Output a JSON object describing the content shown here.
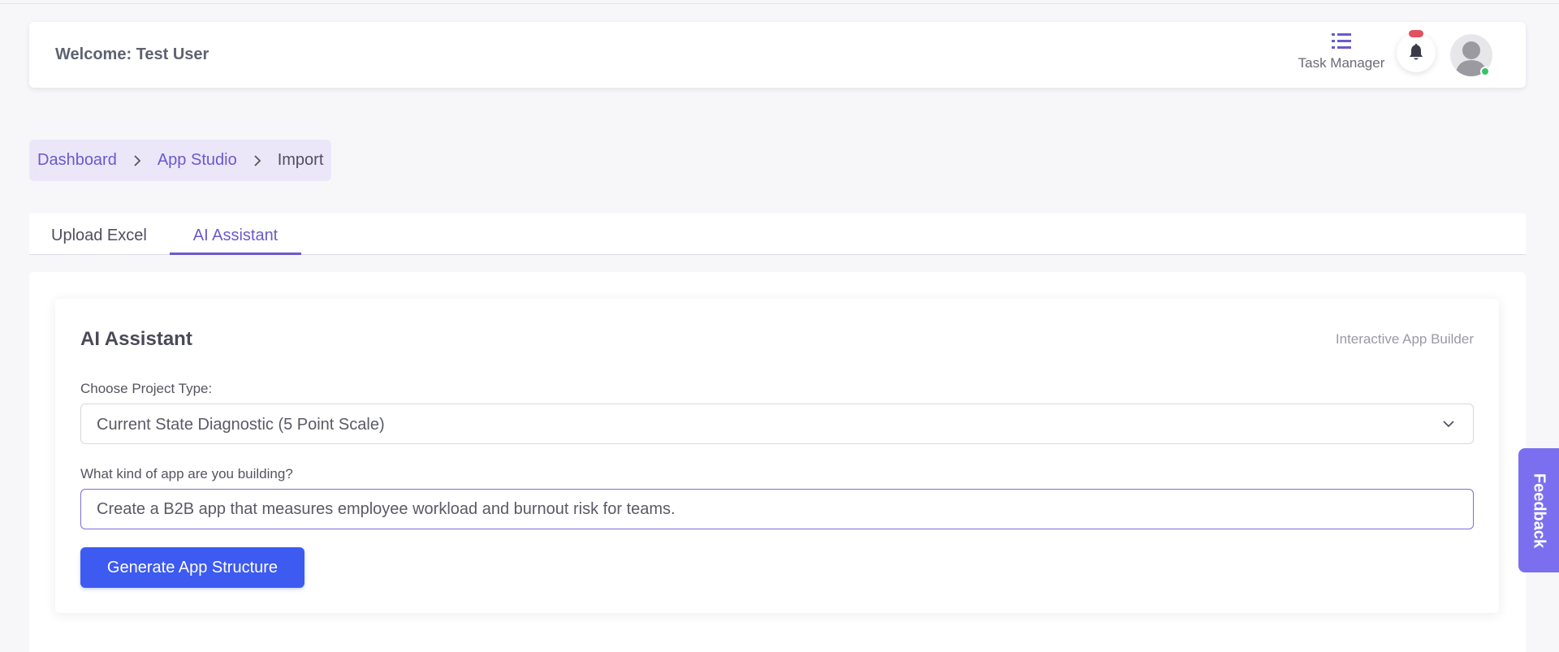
{
  "header": {
    "welcome_text": "Welcome: Test User",
    "task_manager_label": "Task Manager",
    "icons": [
      "list-icon",
      "bell-icon",
      "avatar-icon"
    ]
  },
  "breadcrumb": {
    "items": [
      "Dashboard",
      "App Studio",
      "Import"
    ]
  },
  "tabs": [
    {
      "label": "Upload Excel",
      "active": false
    },
    {
      "label": "AI Assistant",
      "active": true
    }
  ],
  "card": {
    "title": "AI Assistant",
    "subtitle": "Interactive App Builder",
    "project_type_label": "Choose Project Type:",
    "project_type_value": "Current State Diagnostic (5 Point Scale)",
    "app_question_label": "What kind of app are you building?",
    "app_description_value": "Create a B2B app that measures employee workload and burnout risk for teams.",
    "generate_button_label": "Generate App Structure"
  },
  "feedback_label": "Feedback",
  "colors": {
    "accent": "#6a5acd",
    "primary_button": "#3d5af1",
    "breadcrumb_bg": "#ebe7f9",
    "feedback_bg": "#7b6ff0",
    "notification_badge": "#e05260",
    "online_status": "#3ac26a"
  }
}
